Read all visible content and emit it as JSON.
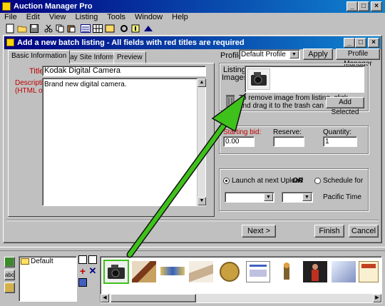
{
  "app": {
    "title": "Auction Manager Pro"
  },
  "menu": [
    "File",
    "Edit",
    "View",
    "Listing",
    "Tools",
    "Window",
    "Help"
  ],
  "dialog": {
    "title": "Add a new batch listing - All fields with red titles are required",
    "tabs": [
      "Basic Information",
      "eBay Site Information",
      "Preview"
    ],
    "profile_label": "Profile",
    "profile_value": "Default Profile",
    "apply_label": "Apply",
    "profile_manager_label": "Profile Manager",
    "title_label": "Title",
    "title_value": "Kodak Digital Camera",
    "description_label": "Description",
    "description_sub": "(HTML ok)",
    "description_value": "Brand new digital camera.",
    "listing_images_label_1": "Listing",
    "listing_images_label_2": "Images:",
    "remove_hint_1": "To remove image from listing, click",
    "remove_hint_2": "and drag it to the trash can",
    "add_selected_label": "Add Selected",
    "starting_bid_label": "Starting bid:",
    "starting_bid_value": "0.00",
    "reserve_label": "Reserve:",
    "reserve_value": "",
    "quantity_label": "Quantity:",
    "quantity_value": "1",
    "launch_label": "Launch at next Upload",
    "or_label": "OR",
    "schedule_label": "Schedule for",
    "pacific_label": "Pacific Time",
    "next_label": "Next >",
    "finish_label": "Finish",
    "cancel_label": "Cancel"
  },
  "folder_panel": {
    "folder_name": "Default"
  },
  "thumbnails": [
    "camera",
    "book",
    "banner",
    "rolled-paper",
    "gold-coin",
    "document-page",
    "figurine",
    "person-photo",
    "blue-card",
    "poster"
  ],
  "colors": {
    "titlebar": "#000080",
    "required": "#c00000",
    "arrow": "#3ec11b"
  }
}
